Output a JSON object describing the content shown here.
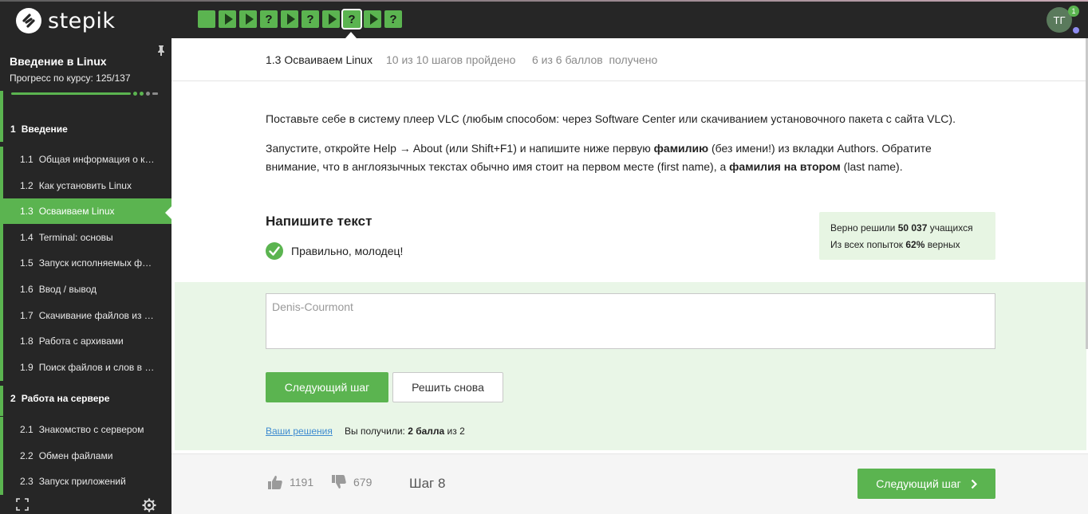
{
  "topbar": {
    "logo_text": "stepik",
    "steps": [
      {
        "kind": "square"
      },
      {
        "kind": "play"
      },
      {
        "kind": "play"
      },
      {
        "kind": "question"
      },
      {
        "kind": "play"
      },
      {
        "kind": "question"
      },
      {
        "kind": "play"
      },
      {
        "kind": "question",
        "current": true
      },
      {
        "kind": "play"
      },
      {
        "kind": "question"
      }
    ],
    "question_glyph": "?",
    "avatar_initials": "ТГ",
    "notification_count": "1"
  },
  "sidebar": {
    "course_title": "Введение в Linux",
    "progress_label": "Прогресс по курсу:",
    "progress_value": "125/137",
    "sections": [
      {
        "num": "1",
        "title": "Введение"
      },
      {
        "num": "2",
        "title": "Работа на сервере"
      }
    ],
    "lessons_s1": [
      {
        "num": "1.1",
        "title": "Общая информация о курсе"
      },
      {
        "num": "1.2",
        "title": "Как установить Linux"
      },
      {
        "num": "1.3",
        "title": "Осваиваем Linux"
      },
      {
        "num": "1.4",
        "title": "Terminal: основы"
      },
      {
        "num": "1.5",
        "title": "Запуск исполняемых файлов"
      },
      {
        "num": "1.6",
        "title": "Ввод / вывод"
      },
      {
        "num": "1.7",
        "title": "Скачивание файлов из интернета"
      },
      {
        "num": "1.8",
        "title": "Работа с архивами"
      },
      {
        "num": "1.9",
        "title": "Поиск файлов и слов в файлах"
      }
    ],
    "lessons_s2": [
      {
        "num": "2.1",
        "title": "Знакомство с сервером"
      },
      {
        "num": "2.2",
        "title": "Обмен файлами"
      },
      {
        "num": "2.3",
        "title": "Запуск приложений"
      }
    ]
  },
  "lesson_header": {
    "title": "1.3 Осваиваем Linux",
    "steps_done": "10 из 10 шагов пройдено",
    "points": "6 из 6 баллов  получено"
  },
  "content": {
    "p1": "Поставьте себе в систему плеер VLC (любым способом: через Software Center или скачиванием установочного пакета с сайта VLC).",
    "p2_a": "Запустите, откройте Help → About (или Shift+F1) и напишите ниже первую ",
    "p2_b": "фамилию",
    "p2_c": " (без имени!) из вкладки Authors. Обратите внимание, что в англоязычных текстах обычно имя стоит на первом месте (first name), а ",
    "p2_d": "фамилия на втором",
    "p2_e": " (last name)."
  },
  "task": {
    "title": "Напишите текст",
    "result": "Правильно, молодец!",
    "stats_line1_a": "Верно решили ",
    "stats_line1_b": "50 037",
    "stats_line1_c": " учащихся",
    "stats_line2_a": "Из всех попыток ",
    "stats_line2_b": "62%",
    "stats_line2_c": " верных",
    "answer_placeholder": "Denis-Courmont",
    "next_button": "Следующий шаг",
    "retry_button": "Решить снова",
    "solutions_link": "Ваши решения",
    "score_a": "Вы получили: ",
    "score_b": "2 балла",
    "score_c": " из 2"
  },
  "footer": {
    "likes": "1191",
    "dislikes": "679",
    "step_label": "Шаг 8",
    "next_button": "Следующий шаг"
  },
  "colors": {
    "brand_green": "#5bb450",
    "dark_bg": "#262626",
    "light_green": "#e9f6e7",
    "link_blue": "#3e8bd0"
  }
}
